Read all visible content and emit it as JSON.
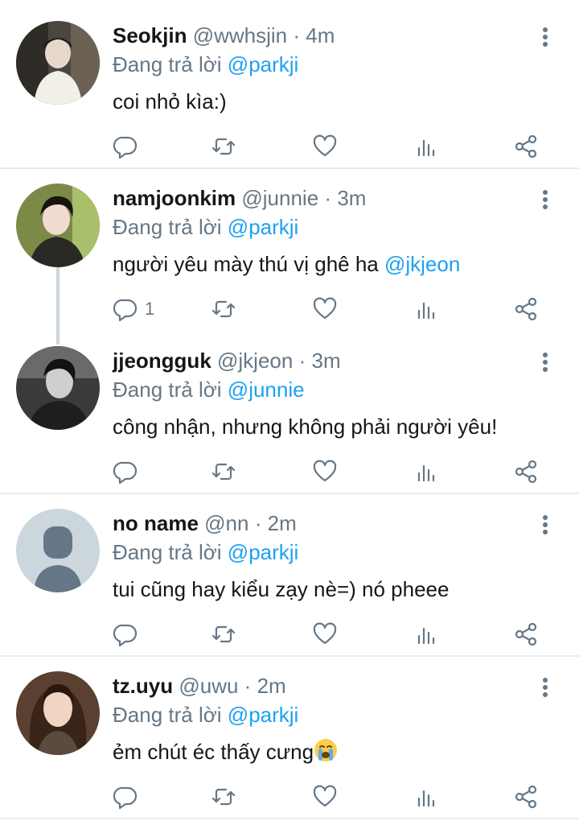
{
  "reply_prefix": "Đang trả lời",
  "icons": {
    "reply": "reply-icon",
    "retweet": "retweet-icon",
    "like": "heart-icon",
    "stats": "bar-chart-icon",
    "share": "share-icon",
    "more": "vertical-ellipsis-icon"
  },
  "colors": {
    "accent": "#1da1f2",
    "secondary_text": "#657786",
    "divider": "#e6ecf0"
  },
  "tweets": [
    {
      "name": "Seokjin",
      "handle": "@wwhsjin",
      "sep": "·",
      "time": "4m",
      "reply_to": "@parkji",
      "text": "coi nhỏ kìa:)",
      "mention": "",
      "reply_count": ""
    },
    {
      "name": "namjoonkim",
      "handle": "@junnie",
      "sep": "·",
      "time": "3m",
      "reply_to": "@parkji",
      "text": "người yêu mày thú vị ghê ha ",
      "mention": "@jkjeon",
      "reply_count": "1"
    },
    {
      "name": "jjeongguk",
      "handle": "@jkjeon",
      "sep": "·",
      "time": "3m",
      "reply_to": "@junnie",
      "text": "công nhận, nhưng không phải người yêu!",
      "mention": "",
      "reply_count": ""
    },
    {
      "name": "no name",
      "handle": "@nn",
      "sep": "·",
      "time": "2m",
      "reply_to": "@parkji",
      "text": "tui cũng hay kiểu zạy nè=) nó pheee",
      "mention": "",
      "reply_count": ""
    },
    {
      "name": "tz.uyu",
      "handle": "@uwu",
      "sep": "·",
      "time": "2m",
      "reply_to": "@parkji",
      "text": "ẻm chút éc thấy cưng",
      "mention": "",
      "reply_count": "",
      "emoji": "crying-face-emoji"
    }
  ]
}
